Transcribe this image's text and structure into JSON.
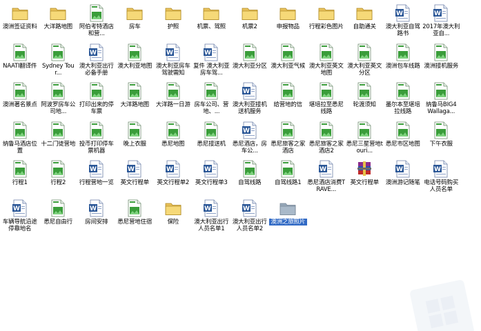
{
  "colors": {
    "selection": "#316ac5",
    "folder": "#f2d27a",
    "image_green": "#3a9d3a",
    "doc_blue": "#2b5797"
  },
  "rows": [
    [
      {
        "label": "澳洲签证资料",
        "type": "folder"
      },
      {
        "label": "大洋路地图",
        "type": "folder"
      },
      {
        "label": "阿伯考特酒店和营...",
        "type": "image"
      },
      {
        "label": "房车",
        "type": "folder"
      },
      {
        "label": "护照",
        "type": "folder"
      },
      {
        "label": "机票、驾照",
        "type": "folder"
      },
      {
        "label": "机票2",
        "type": "folder"
      },
      {
        "label": "申报物品",
        "type": "folder"
      },
      {
        "label": "行程彩色图片",
        "type": "folder"
      },
      {
        "label": "自助通关",
        "type": "folder"
      },
      {
        "label": "澳大利亚自驾路书",
        "type": "doc"
      },
      {
        "label": "2017年澳大利亚自...",
        "type": "doc"
      }
    ],
    [
      {
        "label": "NAATI翻译件",
        "type": "image"
      },
      {
        "label": "Sydney Tour...",
        "type": "image"
      },
      {
        "label": "澳大利亚出行必备手册",
        "type": "doc"
      },
      {
        "label": "澳大利亚地图",
        "type": "image"
      },
      {
        "label": "澳大利亚房车驾驶需知",
        "type": "doc"
      },
      {
        "label": "复件 澳大利亚房车驾...",
        "type": "doc"
      },
      {
        "label": "澳大利亚分区",
        "type": "image"
      },
      {
        "label": "澳大利亚气候",
        "type": "image"
      },
      {
        "label": "澳大利亚英文地图",
        "type": "image"
      },
      {
        "label": "澳大利亚英文分区",
        "type": "image"
      },
      {
        "label": "澳洲包车线路",
        "type": "image"
      },
      {
        "label": "澳洲接机服务",
        "type": "image"
      }
    ],
    [
      {
        "label": "澳洲著名景点",
        "type": "image"
      },
      {
        "label": "阿波罗房车公司地...",
        "type": "image"
      },
      {
        "label": "打印出来的停车票",
        "type": "image"
      },
      {
        "label": "大洋路地图",
        "type": "image"
      },
      {
        "label": "大洋路一日游",
        "type": "image"
      },
      {
        "label": "房车公司、营地、...",
        "type": "image"
      },
      {
        "label": "澳大利亚接机送机服务",
        "type": "doc"
      },
      {
        "label": "给营地的信",
        "type": "image"
      },
      {
        "label": "堪培拉至悉尼线路",
        "type": "image"
      },
      {
        "label": "轮渡须知",
        "type": "image"
      },
      {
        "label": "墨尔本至堪培拉线路",
        "type": "image"
      },
      {
        "label": "纳鲁马BIG4 Wallaga...",
        "type": "image"
      }
    ],
    [
      {
        "label": "纳鲁马酒店位置",
        "type": "image"
      },
      {
        "label": "十二门徒营地",
        "type": "image"
      },
      {
        "label": "投币打印停车票机器",
        "type": "image"
      },
      {
        "label": "晚上衣服",
        "type": "image"
      },
      {
        "label": "悉尼地图",
        "type": "image"
      },
      {
        "label": "悉尼接送机",
        "type": "image"
      },
      {
        "label": "悉尼酒店，房车公...",
        "type": "doc"
      },
      {
        "label": "悉尼旅客之家酒店",
        "type": "image"
      },
      {
        "label": "悉尼旅客之家酒店2",
        "type": "image"
      },
      {
        "label": "悉尼三星营地touri...",
        "type": "image"
      },
      {
        "label": "悉尼市区地图",
        "type": "image"
      },
      {
        "label": "下午衣服",
        "type": "image"
      }
    ],
    [
      {
        "label": "行程1",
        "type": "image"
      },
      {
        "label": "行程2",
        "type": "image"
      },
      {
        "label": "行程营地一览",
        "type": "doc"
      },
      {
        "label": "英文行程单",
        "type": "doc"
      },
      {
        "label": "英文行程单2",
        "type": "doc"
      },
      {
        "label": "英文行程单3",
        "type": "doc"
      },
      {
        "label": "自驾线路",
        "type": "image"
      },
      {
        "label": "自驾线路1",
        "type": "image"
      },
      {
        "label": "悉尼酒店消费TRAVE...",
        "type": "doc"
      },
      {
        "label": "英文行程单",
        "type": "rar"
      },
      {
        "label": "澳洲游记随笔",
        "type": "doc"
      },
      {
        "label": "电话号码购买人员名单",
        "type": "doc"
      }
    ],
    [
      {
        "label": "车辆导航沿途停靠地名",
        "type": "doc"
      },
      {
        "label": "悉尼自由行",
        "type": "image"
      },
      {
        "label": "房间安排",
        "type": "doc"
      },
      {
        "label": "悉尼营地住宿",
        "type": "image"
      },
      {
        "label": "保险",
        "type": "folder"
      },
      {
        "label": "澳大利亚出行人员名单1",
        "type": "doc"
      },
      {
        "label": "澳大利亚出行人员名单2",
        "type": "doc"
      },
      {
        "label": "澳洲之旅照片",
        "type": "folder-gray",
        "selected": true
      }
    ]
  ]
}
